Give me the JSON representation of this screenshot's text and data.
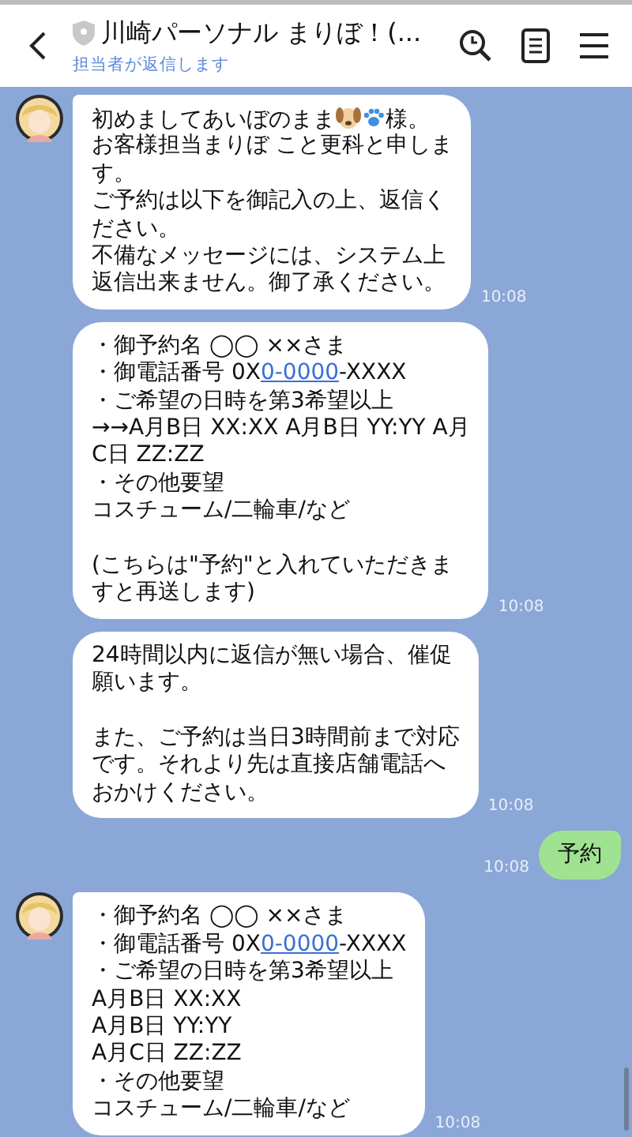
{
  "header": {
    "title": "川崎パーソナル まりぼ！(...",
    "subtitle": "担当者が返信します",
    "verified": true
  },
  "messages": [
    {
      "kind": "received",
      "avatar": true,
      "time": "10:08",
      "paragraphs": [
        [
          {
            "parts": [
              {
                "text": "初めましてあいぼのまま"
              },
              {
                "kind": "dog"
              },
              {
                "kind": "paw"
              },
              {
                "text": "様。"
              }
            ]
          },
          "お客様担当まりぼ こと更科と申しま",
          "す。",
          "ご予約は以下を御記入の上、返信く",
          "ださい。",
          "不備なメッセージには、システム上",
          "返信出来ません。御了承ください。"
        ]
      ]
    },
    {
      "kind": "received",
      "avatar": false,
      "time": "10:08",
      "paragraphs": [
        [
          "・御予約名 ◯◯ ××さま",
          {
            "parts": [
              {
                "text": "・御電話番号 0X"
              },
              {
                "text": "0-0000",
                "link": true
              },
              {
                "text": "-XXXX"
              }
            ]
          },
          "・ご希望の日時を第3希望以上",
          "→→A月B日 XX:XX A月B日 YY:YY A月",
          "C日 ZZ:ZZ",
          "・その他要望",
          "コスチューム/二輪車/など"
        ],
        [
          "(こちらは\"予約\"と入れていただきま",
          "すと再送します)"
        ]
      ]
    },
    {
      "kind": "received",
      "avatar": false,
      "time": "10:08",
      "paragraphs": [
        [
          "24時間以内に返信が無い場合、催促",
          "願います。"
        ],
        [
          "また、ご予約は当日3時間前まで対応",
          "です。それより先は直接店舗電話へ",
          "おかけください。"
        ]
      ]
    },
    {
      "kind": "sent",
      "time": "10:08",
      "paragraphs": [
        [
          "予約"
        ]
      ]
    },
    {
      "kind": "received",
      "avatar": true,
      "time": "10:08",
      "paragraphs": [
        [
          "・御予約名 ◯◯ ××さま",
          {
            "parts": [
              {
                "text": "・御電話番号 0X"
              },
              {
                "text": "0-0000",
                "link": true
              },
              {
                "text": "-XXXX"
              }
            ]
          },
          "・ご希望の日時を第3希望以上",
          "A月B日 XX:XX",
          "A月B日 YY:YY",
          "A月C日 ZZ:ZZ",
          "・その他要望",
          "コスチューム/二輪車/など"
        ]
      ]
    }
  ]
}
